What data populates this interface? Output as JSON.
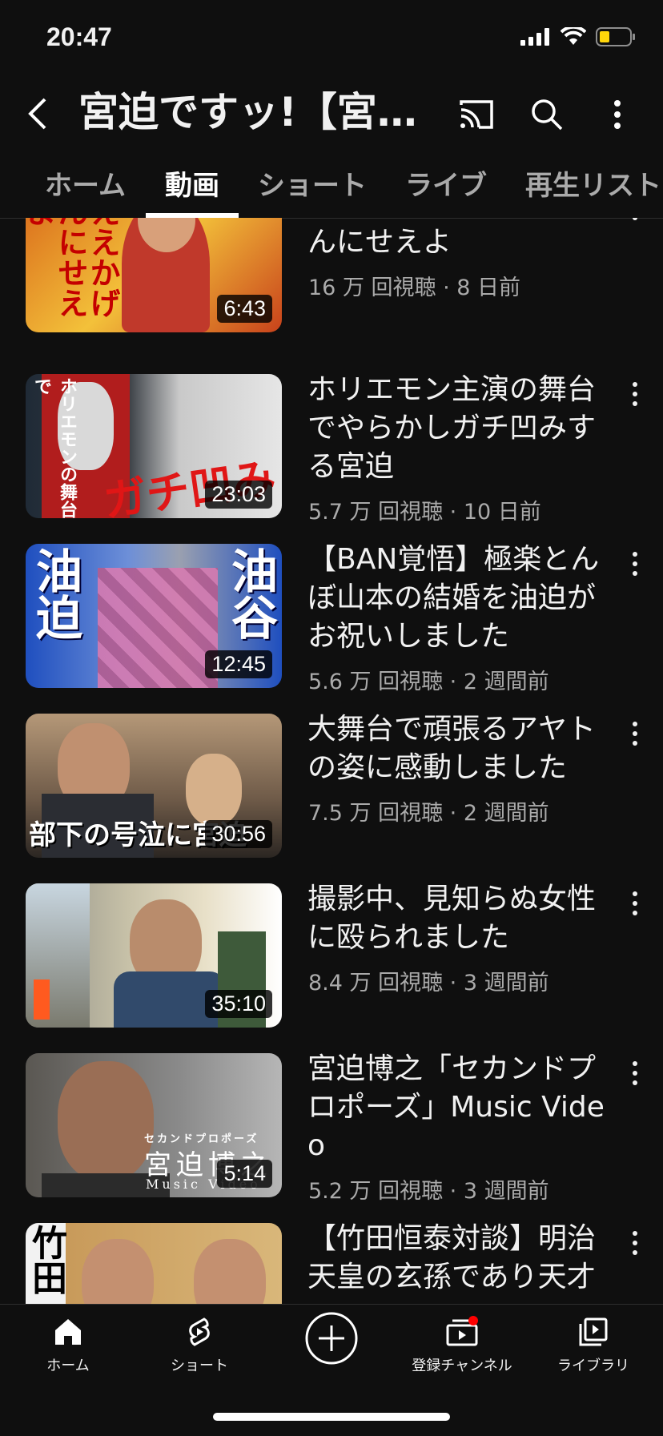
{
  "status_bar": {
    "time": "20:47"
  },
  "header": {
    "title": "宮迫ですッ!【宮…"
  },
  "tabs": [
    {
      "label": "ホーム"
    },
    {
      "label": "動画"
    },
    {
      "label": "ショート"
    },
    {
      "label": "ライブ"
    },
    {
      "label": "再生リスト"
    }
  ],
  "videos": [
    {
      "title": "かまいたち、ええかげんにせえよ",
      "meta": "16 万 回視聴 · 8 日前",
      "duration": "6:43",
      "thumb_text": "ええかげんにせえよ"
    },
    {
      "title": "ホリエモン主演の舞台でやらかしガチ凹みする宮迫",
      "meta": "5.7 万 回視聴 · 10 日前",
      "duration": "23:03",
      "thumb_text": "ガチ凹み"
    },
    {
      "title": "【BAN覚悟】極楽とんぼ山本の結婚を油迫がお祝いしました",
      "meta": "5.6 万 回視聴 · 2 週間前",
      "duration": "12:45",
      "thumb_text_left": "油迫",
      "thumb_text_right": "油谷"
    },
    {
      "title": "大舞台で頑張るアヤトの姿に感動しました",
      "meta": "7.5 万 回視聴 · 2 週間前",
      "duration": "30:56",
      "thumb_text": "部下の号泣に宮迫"
    },
    {
      "title": "撮影中、見知らぬ女性に殴られました",
      "meta": "8.4 万 回視聴 · 3 週間前",
      "duration": "35:10"
    },
    {
      "title": "宮迫博之「セカンドプロポーズ」Music Video",
      "meta": "5.2 万 回視聴 · 3 週間前",
      "duration": "5:14",
      "thumb_text": "宮迫博之",
      "thumb_sub": "Music Video",
      "thumb_small": "セカンドプロポーズ"
    },
    {
      "title": "【竹田恒泰対談】明治天皇の玄孫であり天才",
      "meta": "",
      "duration": "",
      "thumb_text": "竹田"
    }
  ],
  "bottom_nav": [
    {
      "label": "ホーム"
    },
    {
      "label": "ショート"
    },
    {
      "label": ""
    },
    {
      "label": "登録チャンネル"
    },
    {
      "label": "ライブラリ"
    }
  ],
  "colors": {
    "background": "#0f0f0f",
    "accent_red": "#ff0000",
    "battery": "#ffd60a"
  }
}
